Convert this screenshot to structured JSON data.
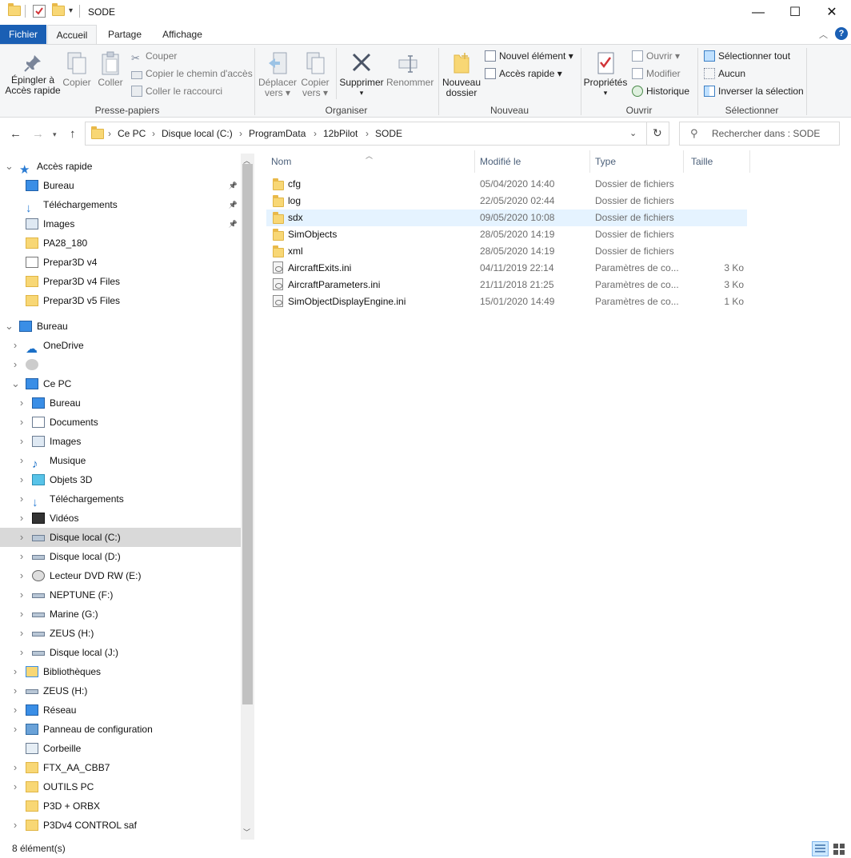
{
  "window": {
    "title": "SODE"
  },
  "tabs": [
    "Fichier",
    "Accueil",
    "Partage",
    "Affichage"
  ],
  "ribbon": {
    "pin": "Épingler à Accès rapide",
    "pin_l1": "Épingler à",
    "pin_l2": "Accès rapide",
    "copy": "Copier",
    "paste": "Coller",
    "cut": "Couper",
    "copy_path": "Copier le chemin d'accès",
    "paste_shortcut": "Coller le raccourci",
    "group_clipboard": "Presse-papiers",
    "move_l1": "Déplacer",
    "move_l2": "vers",
    "copyto_l1": "Copier",
    "copyto_l2": "vers",
    "delete": "Supprimer",
    "rename": "Renommer",
    "group_organize": "Organiser",
    "new_folder_l1": "Nouveau",
    "new_folder_l2": "dossier",
    "new_item": "Nouvel élément",
    "easy_access": "Accès rapide",
    "group_new": "Nouveau",
    "properties": "Propriétés",
    "open": "Ouvrir",
    "edit": "Modifier",
    "history": "Historique",
    "group_open": "Ouvrir",
    "select_all": "Sélectionner tout",
    "select_none": "Aucun",
    "invert": "Inverser la sélection",
    "group_select": "Sélectionner"
  },
  "address": {
    "crumbs": [
      "Ce PC",
      "Disque local (C:)",
      "ProgramData",
      "12bPilot",
      "SODE"
    ]
  },
  "search": {
    "placeholder": "Rechercher dans : SODE"
  },
  "columns": {
    "name": "Nom",
    "modified": "Modifié le",
    "type": "Type",
    "size": "Taille"
  },
  "files": [
    {
      "name": "cfg",
      "modified": "05/04/2020 14:40",
      "type": "Dossier de fichiers",
      "size": "",
      "kind": "folder"
    },
    {
      "name": "log",
      "modified": "22/05/2020 02:44",
      "type": "Dossier de fichiers",
      "size": "",
      "kind": "folder"
    },
    {
      "name": "sdx",
      "modified": "09/05/2020 10:08",
      "type": "Dossier de fichiers",
      "size": "",
      "kind": "folder",
      "selected": true
    },
    {
      "name": "SimObjects",
      "modified": "28/05/2020 14:19",
      "type": "Dossier de fichiers",
      "size": "",
      "kind": "folder"
    },
    {
      "name": "xml",
      "modified": "28/05/2020 14:19",
      "type": "Dossier de fichiers",
      "size": "",
      "kind": "folder"
    },
    {
      "name": "AircraftExits.ini",
      "modified": "04/11/2019 22:14",
      "type": "Paramètres de co...",
      "size": "3 Ko",
      "kind": "file"
    },
    {
      "name": "AircraftParameters.ini",
      "modified": "21/11/2018 21:25",
      "type": "Paramètres de co...",
      "size": "3 Ko",
      "kind": "file"
    },
    {
      "name": "SimObjectDisplayEngine.ini",
      "modified": "15/01/2020 14:49",
      "type": "Paramètres de co...",
      "size": "1 Ko",
      "kind": "file"
    }
  ],
  "nav": [
    {
      "label": "Accès rapide",
      "level": 0,
      "chev": "open",
      "icon": "star-icon"
    },
    {
      "label": "Bureau",
      "level": 1,
      "chev": "",
      "icon": "desktop-icon",
      "pin": true
    },
    {
      "label": "Téléchargements",
      "level": 1,
      "chev": "",
      "icon": "download-icon",
      "pin": true
    },
    {
      "label": "Images",
      "level": 1,
      "chev": "",
      "icon": "pictures-icon",
      "pin": true
    },
    {
      "label": "PA28_180",
      "level": 1,
      "chev": "",
      "icon": "folder-icon"
    },
    {
      "label": "Prepar3D v4",
      "level": 1,
      "chev": "",
      "icon": "shortcut-icon"
    },
    {
      "label": "Prepar3D v4 Files",
      "level": 1,
      "chev": "",
      "icon": "folder-icon"
    },
    {
      "label": "Prepar3D v5 Files",
      "level": 1,
      "chev": "",
      "icon": "folder-icon"
    },
    {
      "label": "Bureau",
      "level": 0,
      "chev": "open",
      "icon": "desktop-icon",
      "gap": true
    },
    {
      "label": "OneDrive",
      "level": 1,
      "chev": "closed",
      "icon": "cloud-icon"
    },
    {
      "label": "",
      "level": 1,
      "chev": "closed",
      "icon": "user-icon"
    },
    {
      "label": "Ce PC",
      "level": 1,
      "chev": "open",
      "icon": "computer-icon"
    },
    {
      "label": "Bureau",
      "level": 2,
      "chev": "closed",
      "icon": "desktop-icon"
    },
    {
      "label": "Documents",
      "level": 2,
      "chev": "closed",
      "icon": "documents-icon"
    },
    {
      "label": "Images",
      "level": 2,
      "chev": "closed",
      "icon": "pictures-icon"
    },
    {
      "label": "Musique",
      "level": 2,
      "chev": "closed",
      "icon": "music-icon"
    },
    {
      "label": "Objets 3D",
      "level": 2,
      "chev": "closed",
      "icon": "cube-icon"
    },
    {
      "label": "Téléchargements",
      "level": 2,
      "chev": "closed",
      "icon": "download-icon"
    },
    {
      "label": "Vidéos",
      "level": 2,
      "chev": "closed",
      "icon": "video-icon"
    },
    {
      "label": "Disque local (C:)",
      "level": 2,
      "chev": "closed",
      "icon": "windows-drive-icon",
      "highlight": true
    },
    {
      "label": "Disque local (D:)",
      "level": 2,
      "chev": "closed",
      "icon": "drive-icon"
    },
    {
      "label": "Lecteur DVD RW (E:)",
      "level": 2,
      "chev": "closed",
      "icon": "dvd-icon"
    },
    {
      "label": "NEPTUNE (F:)",
      "level": 2,
      "chev": "closed",
      "icon": "drive-icon"
    },
    {
      "label": "Marine (G:)",
      "level": 2,
      "chev": "closed",
      "icon": "drive-icon"
    },
    {
      "label": "ZEUS (H:)",
      "level": 2,
      "chev": "closed",
      "icon": "drive-icon"
    },
    {
      "label": "Disque local (J:)",
      "level": 2,
      "chev": "closed",
      "icon": "drive-icon"
    },
    {
      "label": "Bibliothèques",
      "level": 1,
      "chev": "closed",
      "icon": "library-icon"
    },
    {
      "label": "ZEUS (H:)",
      "level": 1,
      "chev": "closed",
      "icon": "drive-icon"
    },
    {
      "label": "Réseau",
      "level": 1,
      "chev": "closed",
      "icon": "network-icon"
    },
    {
      "label": "Panneau de configuration",
      "level": 1,
      "chev": "closed",
      "icon": "control-panel-icon"
    },
    {
      "label": "Corbeille",
      "level": 1,
      "chev": "",
      "icon": "recycle-bin-icon"
    },
    {
      "label": "FTX_AA_CBB7",
      "level": 1,
      "chev": "closed",
      "icon": "folder-icon"
    },
    {
      "label": "OUTILS PC",
      "level": 1,
      "chev": "closed",
      "icon": "folder-icon"
    },
    {
      "label": "P3D + ORBX",
      "level": 1,
      "chev": "",
      "icon": "folder-icon"
    },
    {
      "label": "P3Dv4 CONTROL saf",
      "level": 1,
      "chev": "closed",
      "icon": "folder-icon"
    }
  ],
  "status": {
    "count": "8 élément(s)"
  },
  "colors": {
    "accent": "#1a5fb4",
    "selected_row": "#e5f3ff",
    "nav_highlight": "#d9d9d9",
    "folder": "#f8d775"
  }
}
